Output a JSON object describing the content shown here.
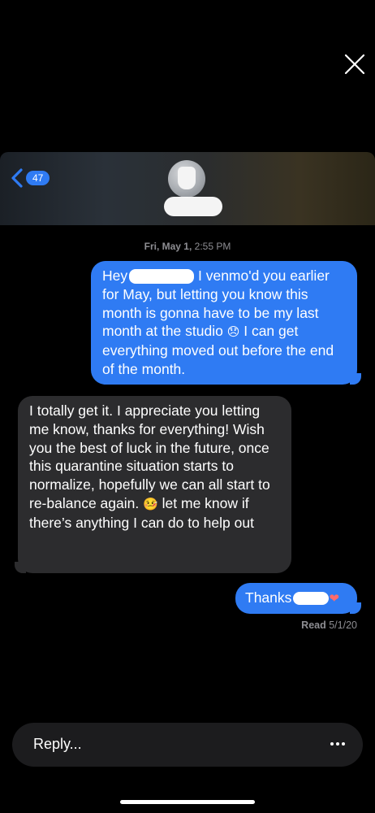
{
  "header": {
    "back_count": "47"
  },
  "thread": {
    "timestamp_day": "Fri, May 1,",
    "timestamp_time": "2:55 PM",
    "messages": [
      {
        "from": "me",
        "part1": "Hey",
        "part2": " I venmo'd you earlier for May, but letting you know this month is gonna have to be my last month at the studio ",
        "emoji": "😞",
        "part3": " I can get everything moved out before the end of the month."
      },
      {
        "from": "them",
        "part1": "I totally get it. I appreciate you letting me know, thanks for everything! Wish you the best of luck in the future, once this quarantine situation starts to normalize, hopefully we can all start to re-balance again. ",
        "emoji": "🤒",
        "part2": " let me know if there’s anything I can do to help out"
      },
      {
        "from": "me",
        "part1": "Thanks",
        "emoji": "❤"
      }
    ],
    "read_label": "Read",
    "read_date": "5/1/20"
  },
  "composer": {
    "placeholder": "Reply..."
  },
  "colors": {
    "outgoing": "#2f7bf3",
    "incoming": "#2c2c2e",
    "background": "#000000"
  },
  "icons": [
    "close-icon",
    "back-chevron-icon",
    "more-icon"
  ]
}
